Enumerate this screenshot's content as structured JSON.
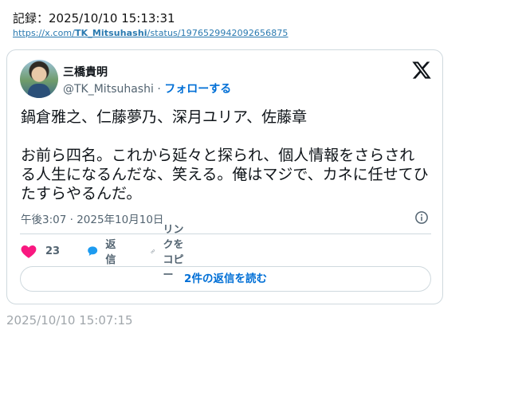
{
  "record": {
    "text": "記録：2025/10/10 15:13:31"
  },
  "source_url": {
    "prefix": "https://x.com/",
    "handle": "TK_Mitsuhashi",
    "suffix": "/status/1976529942092656875"
  },
  "tweet": {
    "author_name": "三橋貴明",
    "handle": "@TK_Mitsuhashi",
    "separator": "·",
    "follow_label": "フォローする",
    "line1": "鍋倉雅之、仁藤夢乃、深月ユリア、佐藤章",
    "line2": "お前ら四名。これから延々と探られ、個人情報をさらされる人生になるんだな、笑える。俺はマジで、カネに任せてひたすらやるんだ。",
    "timestamp": "午後3:07 · 2025年10月10日",
    "like_count": "23",
    "reply_label": "返信",
    "copy_link_label": "リンクをコピー",
    "read_replies_label": "2件の返信を読む"
  },
  "captured_at": "2025/10/10 15:07:15",
  "colors": {
    "accent": "#006fd6",
    "like": "#f91880",
    "reply": "#1d9bf0",
    "border": "#cfd9de",
    "muted": "#536471"
  },
  "icons": [
    "x-logo-icon",
    "info-icon",
    "heart-icon",
    "reply-bubble-icon",
    "link-icon"
  ]
}
